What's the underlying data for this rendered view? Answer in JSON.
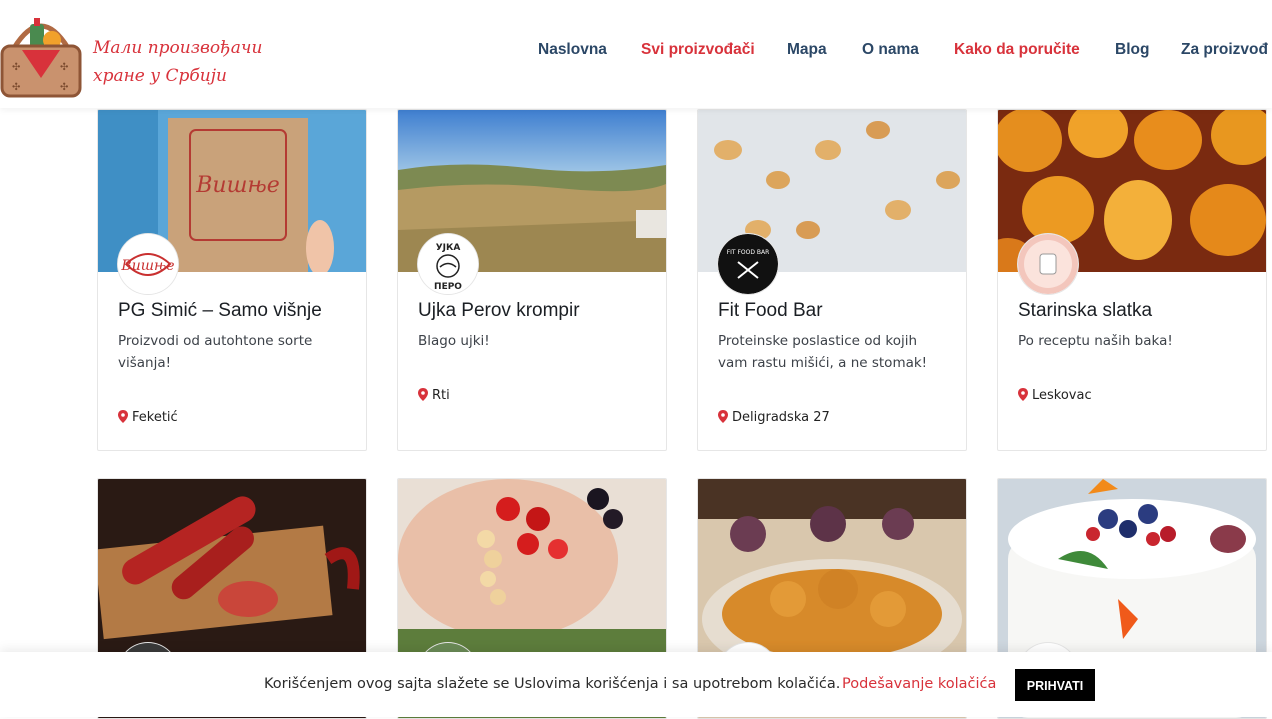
{
  "header": {
    "tagline_line1": "Мали произвођачи",
    "tagline_line2": "хране у Србији",
    "nav": [
      {
        "label": "Naslovna",
        "active": false
      },
      {
        "label": "Svi proizvođači",
        "active": true
      },
      {
        "label": "Mapa",
        "active": false
      },
      {
        "label": "O nama",
        "active": false
      },
      {
        "label": "Kako da poručite",
        "active": true
      },
      {
        "label": "Blog",
        "active": false
      },
      {
        "label": "Za proizvođ",
        "active": false
      }
    ]
  },
  "cards": [
    {
      "title": "PG Simić – Samo višnje",
      "desc": "Proizvodi od autohtone sorte višanja!",
      "location": "Feketić",
      "avatar_text": "Вишње"
    },
    {
      "title": "Ujka Perov krompir",
      "desc": "Blago ujki!",
      "location": "Rti",
      "avatar_text_top": "УЈКА",
      "avatar_text_bottom": "ПЕРО"
    },
    {
      "title": "Fit Food Bar",
      "desc": "Proteinske poslastice od kojih vam rastu mišići, a ne stomak!",
      "location": "Deligradska 27",
      "avatar_text": "FIT FOOD BAR"
    },
    {
      "title": "Starinska slatka",
      "desc": "Po receptu naših baka!",
      "location": "Leskovac"
    }
  ],
  "product_box_text": "Вишње",
  "cookie": {
    "message": "Korišćenjem ovog sajta slažete se Uslovima korišćenja i sa upotrebom kolačića.",
    "settings_label": "Podešavanje kolačića",
    "accept_label": "PRIHVATI"
  },
  "colors": {
    "brand_red": "#d8323b",
    "nav_blue": "#2b4766"
  }
}
